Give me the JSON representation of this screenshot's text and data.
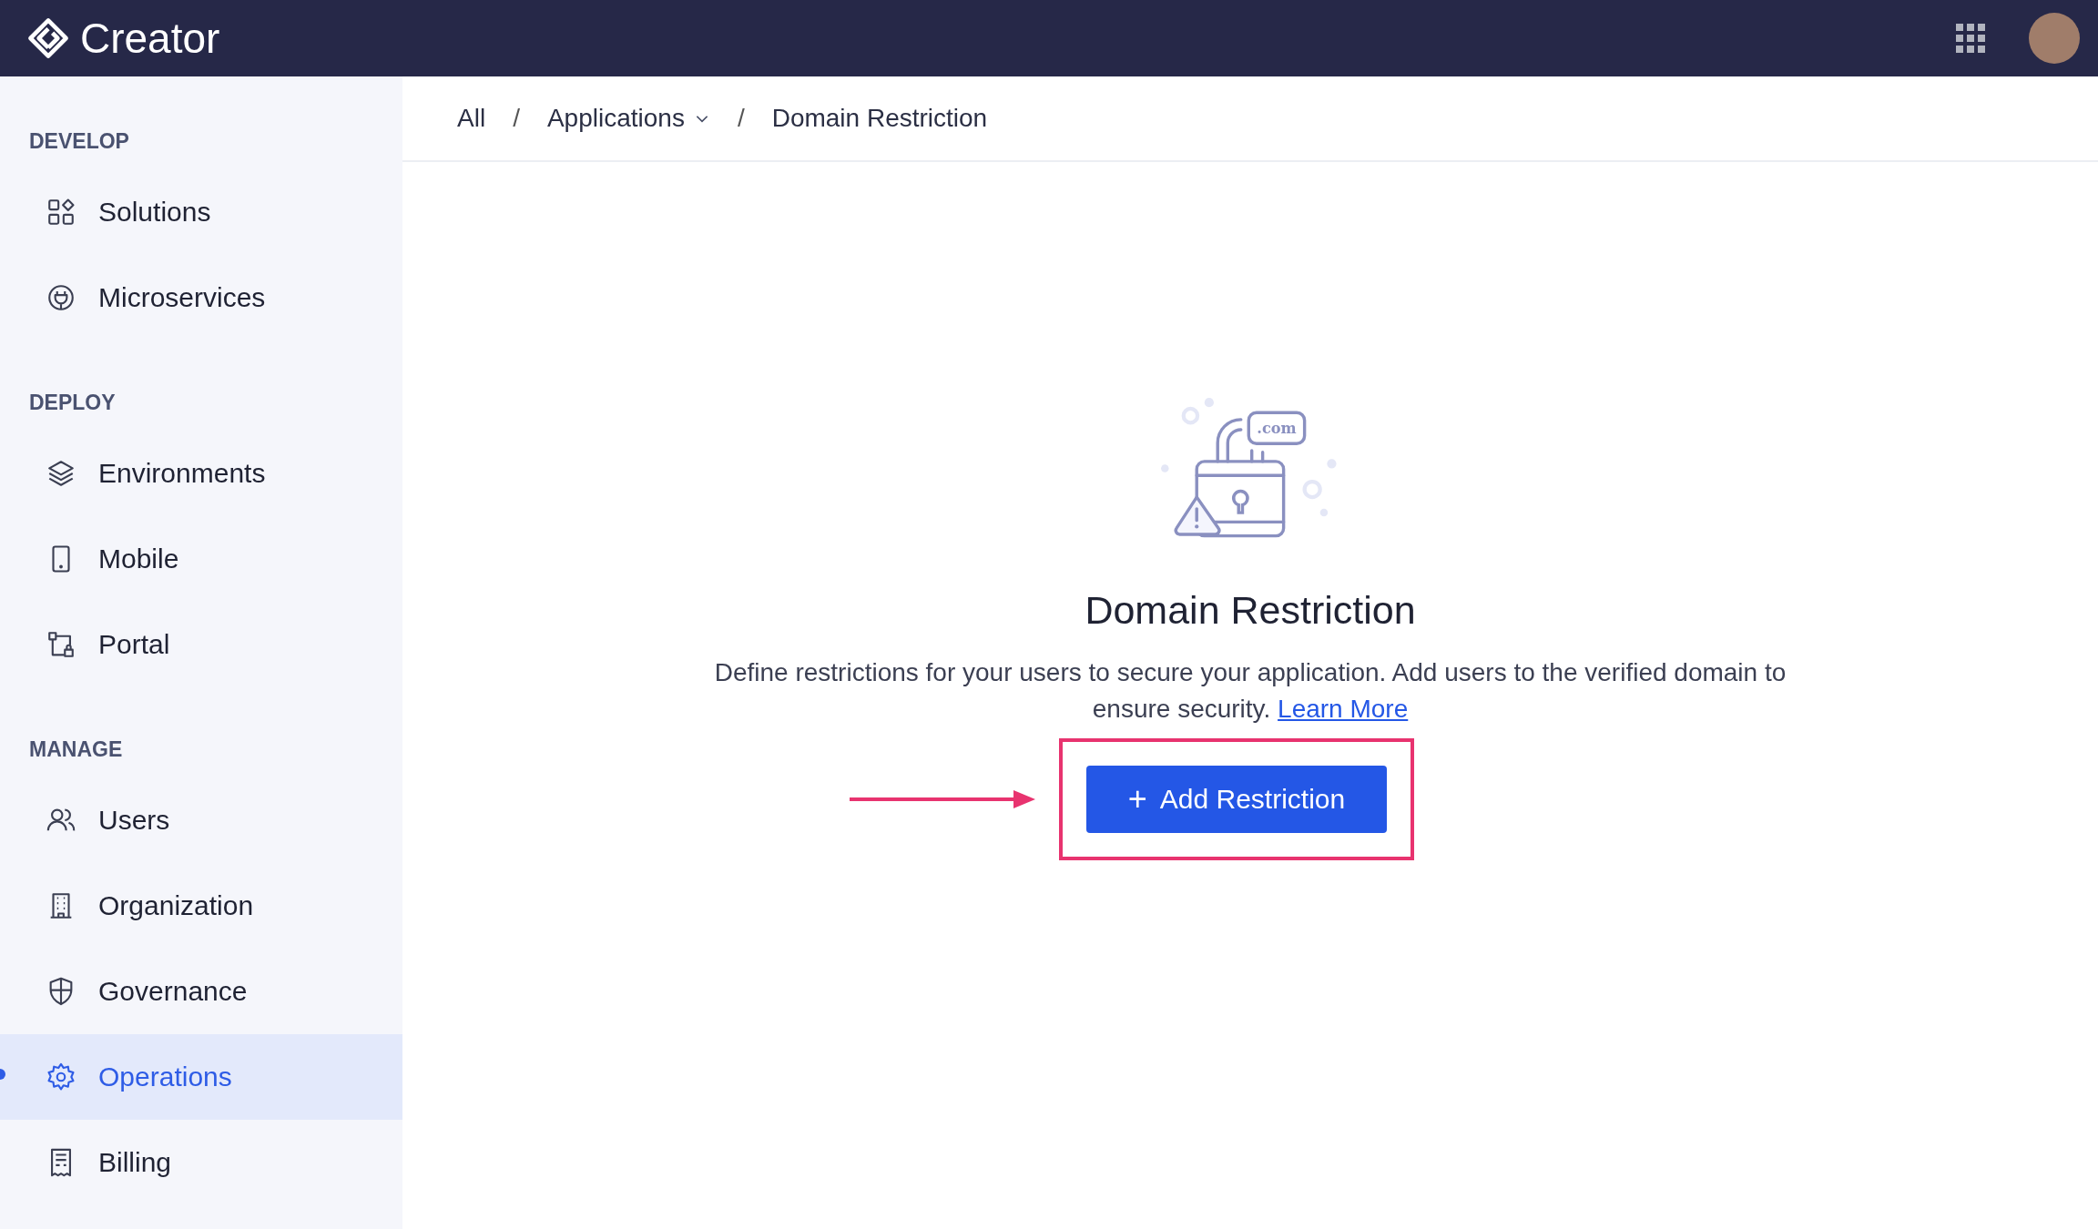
{
  "header": {
    "app_name": "Creator"
  },
  "sidebar": {
    "sections": [
      {
        "title": "DEVELOP",
        "items": [
          {
            "label": "Solutions",
            "selected": false
          },
          {
            "label": "Microservices",
            "selected": false
          }
        ]
      },
      {
        "title": "DEPLOY",
        "items": [
          {
            "label": "Environments",
            "selected": false
          },
          {
            "label": "Mobile",
            "selected": false
          },
          {
            "label": "Portal",
            "selected": false
          }
        ]
      },
      {
        "title": "MANAGE",
        "items": [
          {
            "label": "Users",
            "selected": false
          },
          {
            "label": "Organization",
            "selected": false
          },
          {
            "label": "Governance",
            "selected": false
          },
          {
            "label": "Operations",
            "selected": true
          },
          {
            "label": "Billing",
            "selected": false
          }
        ]
      }
    ]
  },
  "breadcrumb": [
    {
      "label": "All",
      "dropdown": false
    },
    {
      "label": "Applications",
      "dropdown": true
    },
    {
      "label": "Domain Restriction",
      "dropdown": false
    }
  ],
  "breadcrumb_separator": "/",
  "empty_state": {
    "illustration_text": ".com",
    "title": "Domain Restriction",
    "description": "Define restrictions for your users to secure your application. Add users to the verified domain to ensure security.",
    "link": "Learn More",
    "button": {
      "label": "Add Restriction",
      "icon": "+",
      "callout": true
    }
  }
}
